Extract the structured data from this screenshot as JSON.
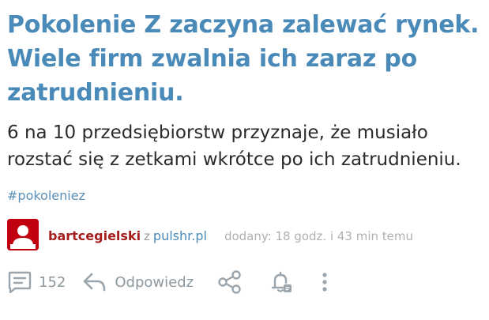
{
  "post": {
    "title": "Pokolenie Z zaczyna zalewać rynek. Wiele firm zwalnia ich zaraz po zatrudnieniu.",
    "lead": "6 na 10 przedsiębiorstw przyznaje, że musiało rozstać się z zetkami wkrótce po ich zatrudnieniu.",
    "tag": "#pokoleniez",
    "author": "bartcegielski",
    "via": "z",
    "source": "pulshr.pl",
    "added": "dodany: 18 godz. i 43 min temu"
  },
  "actions": {
    "comments_count": "152",
    "reply_label": "Odpowiedz"
  },
  "colors": {
    "title": "#4a8ab8",
    "author": "#a51c1c",
    "avatar_bg": "#c0000e",
    "icon": "#9aa5ad"
  },
  "icons": [
    "comment-icon",
    "reply-arrow-icon",
    "share-icon",
    "bell-icon",
    "more-vertical-icon"
  ]
}
